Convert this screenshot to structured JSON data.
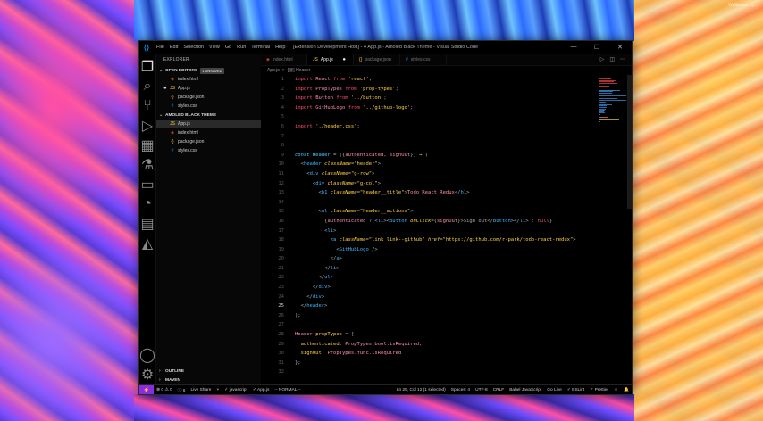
{
  "wallpaper": {
    "watermark": "Wallpaper by..."
  },
  "window": {
    "title": "[Extension Development Host] - ● App.js - Amoled Black Theme - Visual Studio Code",
    "menu": [
      "File",
      "Edit",
      "Selection",
      "View",
      "Go",
      "Run",
      "Terminal",
      "Help"
    ],
    "controls": [
      "—",
      "☐",
      "✕"
    ]
  },
  "activity": [
    "files-icon",
    "search-icon",
    "source-control-icon",
    "debug-icon",
    "extensions-icon",
    "test-icon",
    "remote-explorer-icon",
    "git-icon",
    "terminal-icon",
    "docker-icon"
  ],
  "explorer": {
    "header": "EXPLORER",
    "open_editors": {
      "title": "OPEN EDITORS",
      "badge": "1 UNSAVED",
      "files": [
        "index.html",
        "App.js",
        "package.json",
        "styles.css"
      ]
    },
    "project": {
      "title": "AMOLED BLACK THEME",
      "files": [
        "App.js",
        "index.html",
        "package.json",
        "styles.css"
      ]
    },
    "outline": "OUTLINE",
    "maven": "MAVEN"
  },
  "tabs": [
    {
      "label": "index.html",
      "icon": "html"
    },
    {
      "label": "App.js",
      "icon": "js",
      "active": true
    },
    {
      "label": "package.json",
      "icon": "json"
    },
    {
      "label": "styles.css",
      "icon": "css"
    }
  ],
  "breadcrumb": [
    "App.js",
    ">",
    "[@] Header"
  ],
  "code": {
    "current_line": "25",
    "lines": [
      {
        "n": "1",
        "t": [
          [
            "kw",
            "import "
          ],
          [
            "id",
            "React "
          ],
          [
            "kw",
            "from "
          ],
          [
            "str",
            "'react'"
          ],
          [
            "punc",
            ";"
          ]
        ]
      },
      {
        "n": "2",
        "t": [
          [
            "kw",
            "import "
          ],
          [
            "id",
            "PropTypes "
          ],
          [
            "kw",
            "from "
          ],
          [
            "str",
            "'prop-types'"
          ],
          [
            "punc",
            ";"
          ]
        ]
      },
      {
        "n": "3",
        "t": [
          [
            "kw",
            "import "
          ],
          [
            "id",
            "Button "
          ],
          [
            "kw",
            "from "
          ],
          [
            "str",
            "'../button'"
          ],
          [
            "punc",
            ";"
          ]
        ]
      },
      {
        "n": "4",
        "t": [
          [
            "kw",
            "import "
          ],
          [
            "id",
            "GitHubLogo "
          ],
          [
            "kw",
            "from "
          ],
          [
            "str",
            "'../github-logo'"
          ],
          [
            "punc",
            ";"
          ]
        ]
      },
      {
        "n": "5",
        "t": []
      },
      {
        "n": "6",
        "t": [
          [
            "kw",
            "import "
          ],
          [
            "str",
            "'./header.css'"
          ],
          [
            "punc",
            ";"
          ]
        ]
      },
      {
        "n": "7",
        "t": []
      },
      {
        "n": "8",
        "t": []
      },
      {
        "n": "9",
        "t": [
          [
            "fn",
            "const "
          ],
          [
            "cls",
            "Header "
          ],
          [
            "punc",
            "= ({"
          ],
          [
            "id",
            "authenticated"
          ],
          [
            "punc",
            ", "
          ],
          [
            "id",
            "signOut"
          ],
          [
            "punc",
            "}) "
          ],
          [
            "str",
            "⇒"
          ],
          [
            "punc",
            " ("
          ]
        ]
      },
      {
        "n": "10",
        "t": [
          [
            "punc",
            "  <"
          ],
          [
            "tag",
            "header "
          ],
          [
            "attr",
            "className"
          ],
          [
            "punc",
            "="
          ],
          [
            "str",
            "\"header\""
          ],
          [
            "punc",
            ">"
          ]
        ]
      },
      {
        "n": "11",
        "t": [
          [
            "punc",
            "    <"
          ],
          [
            "tag",
            "div "
          ],
          [
            "attr",
            "className"
          ],
          [
            "punc",
            "="
          ],
          [
            "str",
            "\"g-row\""
          ],
          [
            "punc",
            ">"
          ]
        ]
      },
      {
        "n": "12",
        "t": [
          [
            "punc",
            "      <"
          ],
          [
            "tag",
            "div "
          ],
          [
            "attr",
            "className"
          ],
          [
            "punc",
            "="
          ],
          [
            "str",
            "\"g-col\""
          ],
          [
            "punc",
            ">"
          ]
        ]
      },
      {
        "n": "13",
        "t": [
          [
            "punc",
            "        <"
          ],
          [
            "tag",
            "h1 "
          ],
          [
            "attr",
            "className"
          ],
          [
            "punc",
            "="
          ],
          [
            "str",
            "\"header__title\""
          ],
          [
            "punc",
            ">"
          ],
          [
            "id",
            "Todo React Redux"
          ],
          [
            "punc",
            "</"
          ],
          [
            "tag",
            "h1"
          ],
          [
            "punc",
            ">"
          ]
        ]
      },
      {
        "n": "14",
        "t": []
      },
      {
        "n": "15",
        "t": [
          [
            "punc",
            "        <"
          ],
          [
            "tag",
            "ul "
          ],
          [
            "attr",
            "className"
          ],
          [
            "punc",
            "="
          ],
          [
            "str",
            "\"header__actions\""
          ],
          [
            "punc",
            ">"
          ]
        ]
      },
      {
        "n": "16",
        "t": [
          [
            "punc",
            "          {"
          ],
          [
            "id",
            "authenticated "
          ],
          [
            "punc",
            "? <"
          ],
          [
            "tag",
            "li"
          ],
          [
            "punc",
            "><"
          ],
          [
            "tag",
            "Button "
          ],
          [
            "attr",
            "onClick"
          ],
          [
            "punc",
            "={"
          ],
          [
            "id",
            "signOut"
          ],
          [
            "punc",
            "}>Sign out</"
          ],
          [
            "tag",
            "Button"
          ],
          [
            "punc",
            "></"
          ],
          [
            "tag",
            "li"
          ],
          [
            "punc",
            "> : "
          ],
          [
            "kw",
            "null"
          ],
          [
            "punc",
            "}"
          ]
        ]
      },
      {
        "n": "17",
        "t": [
          [
            "punc",
            "          <"
          ],
          [
            "tag",
            "li"
          ],
          [
            "punc",
            ">"
          ]
        ]
      },
      {
        "n": "18",
        "t": [
          [
            "punc",
            "            <"
          ],
          [
            "tag",
            "a "
          ],
          [
            "attr",
            "className"
          ],
          [
            "punc",
            "="
          ],
          [
            "str",
            "\"link link--github\" "
          ],
          [
            "attr",
            "href"
          ],
          [
            "punc",
            "="
          ],
          [
            "str",
            "\"https://github.com/r-park/todo-react-redux\""
          ],
          [
            "punc",
            ">"
          ]
        ]
      },
      {
        "n": "19",
        "t": [
          [
            "punc",
            "              <"
          ],
          [
            "tag",
            "GitHubLogo "
          ],
          [
            "punc",
            "/>"
          ]
        ]
      },
      {
        "n": "20",
        "t": [
          [
            "punc",
            "            </"
          ],
          [
            "tag",
            "a"
          ],
          [
            "punc",
            ">"
          ]
        ]
      },
      {
        "n": "21",
        "t": [
          [
            "punc",
            "          </"
          ],
          [
            "tag",
            "li"
          ],
          [
            "punc",
            ">"
          ]
        ]
      },
      {
        "n": "22",
        "t": [
          [
            "punc",
            "        </"
          ],
          [
            "tag",
            "ul"
          ],
          [
            "punc",
            ">"
          ]
        ]
      },
      {
        "n": "23",
        "t": [
          [
            "punc",
            "      </"
          ],
          [
            "tag",
            "div"
          ],
          [
            "punc",
            ">"
          ]
        ]
      },
      {
        "n": "24",
        "t": [
          [
            "punc",
            "    </"
          ],
          [
            "tag",
            "div"
          ],
          [
            "punc",
            ">"
          ]
        ]
      },
      {
        "n": "25",
        "t": [
          [
            "punc",
            "  </"
          ],
          [
            "tag",
            "header"
          ],
          [
            "punc",
            ">"
          ]
        ]
      },
      {
        "n": "26",
        "t": [
          [
            "punc",
            ");"
          ]
        ]
      },
      {
        "n": "27",
        "t": []
      },
      {
        "n": "28",
        "t": [
          [
            "id",
            "Header"
          ],
          [
            "punc",
            "."
          ],
          [
            "prop",
            "propTypes "
          ],
          [
            "punc",
            "= {"
          ]
        ]
      },
      {
        "n": "29",
        "t": [
          [
            "prop",
            "  authenticated"
          ],
          [
            "punc",
            ": "
          ],
          [
            "id",
            "PropTypes"
          ],
          [
            "punc",
            "."
          ],
          [
            "id",
            "bool"
          ],
          [
            "punc",
            "."
          ],
          [
            "id",
            "isRequired"
          ],
          [
            "punc",
            ","
          ]
        ]
      },
      {
        "n": "30",
        "t": [
          [
            "prop",
            "  signOut"
          ],
          [
            "punc",
            ": "
          ],
          [
            "id",
            "PropTypes"
          ],
          [
            "punc",
            "."
          ],
          [
            "id",
            "func"
          ],
          [
            "punc",
            "."
          ],
          [
            "id",
            "isRequired"
          ]
        ]
      },
      {
        "n": "31",
        "t": [
          [
            "punc",
            "};"
          ]
        ]
      },
      {
        "n": "32",
        "t": []
      }
    ]
  },
  "status": {
    "remote": "⚡",
    "errors": "⊗ 0 ⚠ 0",
    "info": "ⓘ 6",
    "live_share": "Live Share",
    "branch": "⑂",
    "lang_check": "✓ javascript",
    "file_check": "✓ App.js",
    "mode": "-- NORMAL --",
    "position": "Ln 25, Col 12 (1 selected)",
    "spaces": "Spaces: 4",
    "encoding": "UTF-8",
    "eol": "CRLF",
    "language": "Babel JavaScript",
    "golive": "Go Live",
    "eslint": "✓ ESLint",
    "prettier": "✓ Prettier",
    "feedback": "☺",
    "bell": "🔔"
  }
}
